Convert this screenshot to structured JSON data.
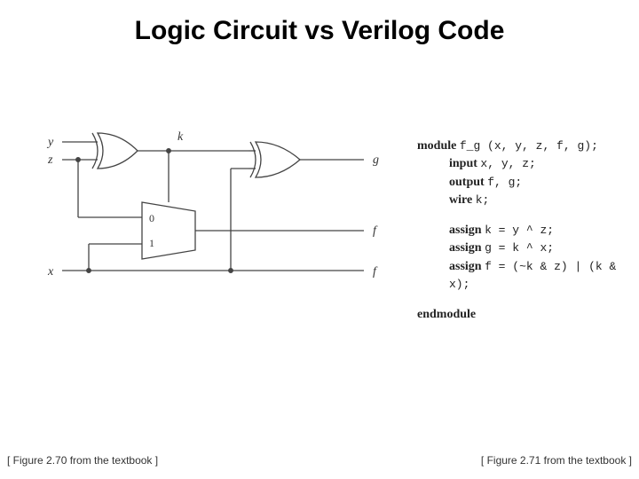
{
  "title": "Logic Circuit vs Verilog Code",
  "signals": {
    "y": "y",
    "z": "z",
    "x": "x",
    "k": "k",
    "g": "g",
    "f": "f"
  },
  "mux": {
    "in0": "0",
    "in1": "1"
  },
  "verilog": {
    "module": "module",
    "modname": "f_g (x, y, z, f, g);",
    "input": "input",
    "input_args": "x, y, z;",
    "output": "output",
    "output_args": "f, g;",
    "wire": "wire",
    "wire_args": "k;",
    "assign": "assign",
    "a_k": "k = y ^ z;",
    "a_g": "g = k ^ x;",
    "a_f": "f = (~k & z) | (k & x);",
    "endmodule": "endmodule"
  },
  "caption_left": "[ Figure 2.70 from the textbook ]",
  "caption_right": "[ Figure 2.71 from the textbook ]"
}
